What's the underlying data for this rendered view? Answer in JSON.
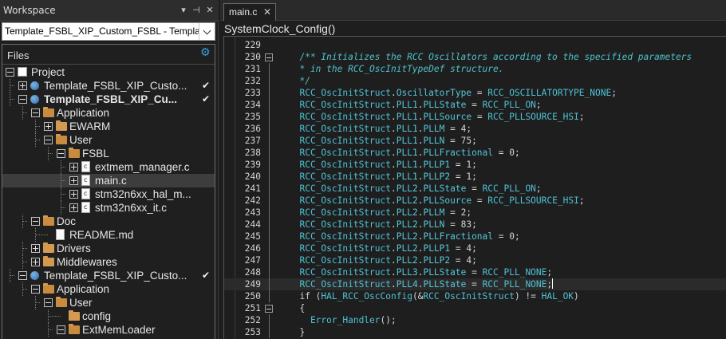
{
  "workspace": {
    "title": "Workspace",
    "pin_icon": "pin-icon",
    "close_icon": "close-icon",
    "combo_value": "Template_FSBL_XIP_Custom_FSBL - Template_FS",
    "files_label": "Files"
  },
  "tree": [
    {
      "label": "Project",
      "depth": 0,
      "icon": "project-root-icon",
      "expanded": true
    },
    {
      "label": "Template_FSBL_XIP_Custo...",
      "depth": 1,
      "icon": "project-icon",
      "expanded": false,
      "checked": true
    },
    {
      "label": "Template_FSBL_XIP_Cu...",
      "depth": 1,
      "icon": "project-icon",
      "expanded": true,
      "checked": true,
      "bold": true
    },
    {
      "label": "Application",
      "depth": 2,
      "icon": "folder-icon",
      "expanded": true
    },
    {
      "label": "EWARM",
      "depth": 3,
      "icon": "folder-icon",
      "expanded": false
    },
    {
      "label": "User",
      "depth": 3,
      "icon": "folder-icon",
      "expanded": true
    },
    {
      "label": "FSBL",
      "depth": 4,
      "icon": "folder-icon",
      "expanded": true
    },
    {
      "label": "extmem_manager.c",
      "depth": 5,
      "icon": "c-file-icon",
      "expanded": false
    },
    {
      "label": "main.c",
      "depth": 5,
      "icon": "c-file-icon",
      "expanded": false,
      "selected": true
    },
    {
      "label": "stm32n6xx_hal_m...",
      "depth": 5,
      "icon": "c-file-icon",
      "expanded": false
    },
    {
      "label": "stm32n6xx_it.c",
      "depth": 5,
      "icon": "c-file-icon",
      "expanded": false
    },
    {
      "label": "Doc",
      "depth": 2,
      "icon": "folder-icon",
      "expanded": true
    },
    {
      "label": "README.md",
      "depth": 3,
      "icon": "document-icon",
      "leaf": true
    },
    {
      "label": "Drivers",
      "depth": 2,
      "icon": "folder-icon",
      "expanded": false
    },
    {
      "label": "Middlewares",
      "depth": 2,
      "icon": "folder-icon",
      "expanded": false
    },
    {
      "label": "Template_FSBL_XIP_Custo...",
      "depth": 1,
      "icon": "project-icon",
      "expanded": true,
      "checked": true
    },
    {
      "label": "Application",
      "depth": 2,
      "icon": "folder-icon",
      "expanded": true
    },
    {
      "label": "User",
      "depth": 3,
      "icon": "folder-icon",
      "expanded": true
    },
    {
      "label": "config",
      "depth": 4,
      "icon": "folder-icon",
      "leaf": true
    },
    {
      "label": "ExtMemLoader",
      "depth": 4,
      "icon": "folder-icon",
      "expanded": true
    }
  ],
  "editor": {
    "tab_label": "main.c",
    "function_label": "SystemClock_Config()",
    "lines": [
      {
        "n": "229",
        "code": ""
      },
      {
        "n": "230",
        "code": "  /** Initializes the RCC Oscillators according to the specified parameters",
        "fold": true,
        "comment": true
      },
      {
        "n": "231",
        "code": "  * in the RCC_OscInitTypeDef structure.",
        "comment": true
      },
      {
        "n": "232",
        "code": "  */",
        "comment": true
      },
      {
        "n": "233",
        "code": "  RCC_OscInitStruct.OscillatorType = RCC_OSCILLATORTYPE_NONE;"
      },
      {
        "n": "234",
        "code": "  RCC_OscInitStruct.PLL1.PLLState = RCC_PLL_ON;"
      },
      {
        "n": "235",
        "code": "  RCC_OscInitStruct.PLL1.PLLSource = RCC_PLLSOURCE_HSI;"
      },
      {
        "n": "236",
        "code": "  RCC_OscInitStruct.PLL1.PLLM = 4;"
      },
      {
        "n": "237",
        "code": "  RCC_OscInitStruct.PLL1.PLLN = 75;"
      },
      {
        "n": "238",
        "code": "  RCC_OscInitStruct.PLL1.PLLFractional = 0;"
      },
      {
        "n": "239",
        "code": "  RCC_OscInitStruct.PLL1.PLLP1 = 1;"
      },
      {
        "n": "240",
        "code": "  RCC_OscInitStruct.PLL1.PLLP2 = 1;"
      },
      {
        "n": "241",
        "code": "  RCC_OscInitStruct.PLL2.PLLState = RCC_PLL_ON;"
      },
      {
        "n": "242",
        "code": "  RCC_OscInitStruct.PLL2.PLLSource = RCC_PLLSOURCE_HSI;"
      },
      {
        "n": "243",
        "code": "  RCC_OscInitStruct.PLL2.PLLM = 2;"
      },
      {
        "n": "244",
        "code": "  RCC_OscInitStruct.PLL2.PLLN = 83;"
      },
      {
        "n": "245",
        "code": "  RCC_OscInitStruct.PLL2.PLLFractional = 0;"
      },
      {
        "n": "246",
        "code": "  RCC_OscInitStruct.PLL2.PLLP1 = 4;"
      },
      {
        "n": "247",
        "code": "  RCC_OscInitStruct.PLL2.PLLP2 = 4;"
      },
      {
        "n": "248",
        "code": "  RCC_OscInitStruct.PLL3.PLLState = RCC_PLL_NONE;"
      },
      {
        "n": "249",
        "code": "  RCC_OscInitStruct.PLL4.PLLState = RCC_PLL_NONE;",
        "current": true
      },
      {
        "n": "250",
        "code": "  if (HAL_RCC_OscConfig(&RCC_OscInitStruct) != HAL_OK)"
      },
      {
        "n": "251",
        "code": "  {",
        "fold": true
      },
      {
        "n": "252",
        "code": "    Error_Handler();"
      },
      {
        "n": "253",
        "code": "  }"
      }
    ]
  },
  "colors": {
    "comment": "#4fc1c9",
    "identifier": "#4fc1d4",
    "plain": "#e6e6e6",
    "folder": "#d49a52",
    "gear": "#3c9ee0"
  }
}
